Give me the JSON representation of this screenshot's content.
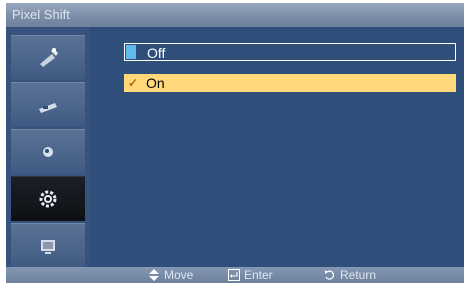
{
  "title": "Pixel Shift",
  "sidebar": {
    "items": [
      {
        "icon": "picture-settings-icon"
      },
      {
        "icon": "sound-icon"
      },
      {
        "icon": "circle-icon"
      },
      {
        "icon": "gear-icon",
        "active": true
      },
      {
        "icon": "multi-screen-icon"
      }
    ]
  },
  "options": {
    "off_label": "Off",
    "on_label": "On",
    "selected": "On",
    "check_glyph": "✓"
  },
  "bottom": {
    "move_label": "Move",
    "enter_label": "Enter",
    "return_label": "Return"
  },
  "colors": {
    "panel": "#2f4e79",
    "highlight": "#ffd87a",
    "marker": "#5dbcec"
  }
}
